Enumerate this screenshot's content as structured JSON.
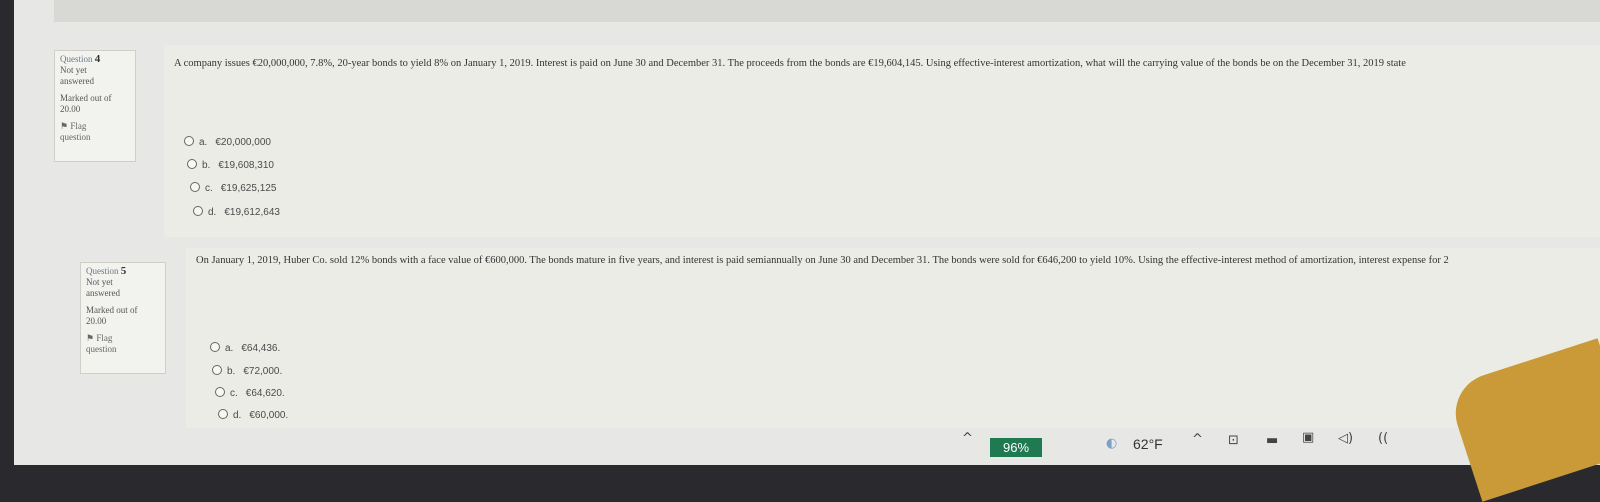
{
  "questions": [
    {
      "label": "Question",
      "number": "4",
      "status_line1": "Not yet",
      "status_line2": "answered",
      "marked_line1": "Marked out of",
      "marked_line2": "20.00",
      "flag_line1": "Flag",
      "flag_line2": "question",
      "text": "A company issues €20,000,000, 7.8%, 20-year bonds to yield 8% on January 1, 2019. Interest is paid on June 30 and December 31. The proceeds from the bonds are €19,604,145. Using effective-interest amortization, what will the carrying value of the bonds be on the December 31, 2019 state",
      "options": [
        {
          "letter": "a.",
          "value": "€20,000,000"
        },
        {
          "letter": "b.",
          "value": "€19,608,310"
        },
        {
          "letter": "c.",
          "value": "€19,625,125"
        },
        {
          "letter": "d.",
          "value": "€19,612,643"
        }
      ]
    },
    {
      "label": "Question",
      "number": "5",
      "status_line1": "Not yet",
      "status_line2": "answered",
      "marked_line1": "Marked out of",
      "marked_line2": "20.00",
      "flag_line1": "Flag",
      "flag_line2": "question",
      "text": "On January 1, 2019, Huber Co. sold 12% bonds with a face value of €600,000. The bonds mature in five years, and interest is paid semiannually on June 30 and December 31. The bonds were sold for €646,200 to yield 10%. Using the effective-interest method of amortization, interest expense for 2",
      "options": [
        {
          "letter": "a.",
          "value": "€64,436."
        },
        {
          "letter": "b.",
          "value": "€72,000."
        },
        {
          "letter": "c.",
          "value": "€64,620."
        },
        {
          "letter": "d.",
          "value": "€60,000."
        }
      ]
    }
  ],
  "taskbar": {
    "battery": "96%",
    "temperature": "62°F",
    "icons": [
      "chevron-up-icon",
      "weather-icon",
      "chevron-up-icon",
      "notes-icon",
      "camera-icon",
      "display-icon",
      "volume-icon",
      "wifi-icon"
    ]
  },
  "colors": {
    "screen_bg": "#e7e8e6",
    "battery_bg": "#1f7a52"
  }
}
